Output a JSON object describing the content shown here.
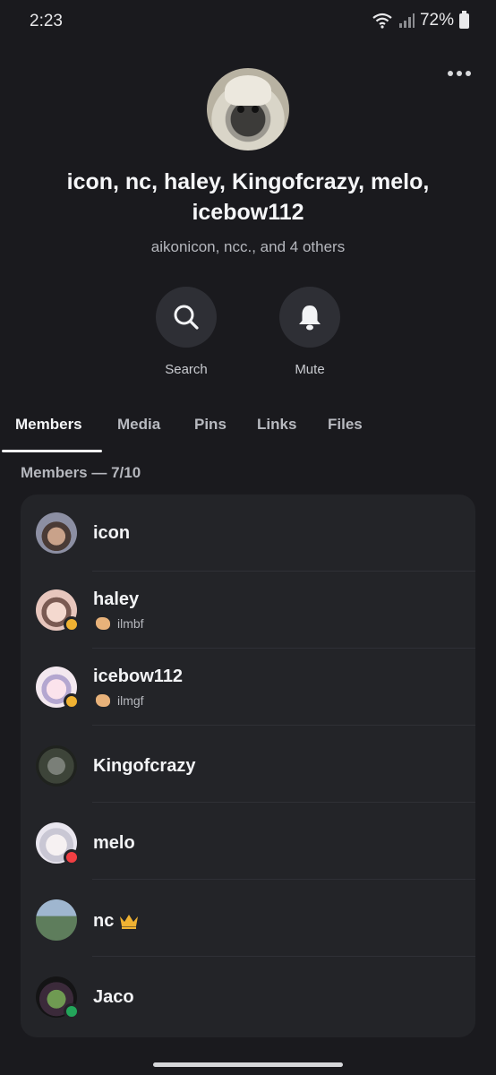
{
  "status_bar": {
    "time": "2:23",
    "battery": "72%"
  },
  "group": {
    "title": "icon, nc, haley, Kingofcrazy, melo, icebow112",
    "subtitle": "aikonicon, ncc., and 4 others"
  },
  "actions": {
    "search_label": "Search",
    "mute_label": "Mute"
  },
  "tabs": [
    {
      "label": "Members"
    },
    {
      "label": "Media"
    },
    {
      "label": "Pins"
    },
    {
      "label": "Links"
    },
    {
      "label": "Files"
    }
  ],
  "members_header": "Members — 7/10",
  "members": [
    {
      "name": "icon",
      "status": ""
    },
    {
      "name": "haley",
      "status": "ilmbf"
    },
    {
      "name": "icebow112",
      "status": "ilmgf"
    },
    {
      "name": "Kingofcrazy",
      "status": ""
    },
    {
      "name": "melo",
      "status": ""
    },
    {
      "name": "nc",
      "status": ""
    },
    {
      "name": "Jaco",
      "status": ""
    }
  ],
  "icons": {
    "more": "more-horizontal-icon",
    "search": "search-icon",
    "mute": "bell-icon",
    "crown": "crown-icon",
    "idle": "idle-moon-icon",
    "dnd": "do-not-disturb-icon",
    "online": "online-dot-icon"
  },
  "colors": {
    "background": "#1a1a1e",
    "card": "#232428",
    "idle": "#f0b232",
    "dnd": "#f23f43",
    "online": "#23a55a"
  }
}
